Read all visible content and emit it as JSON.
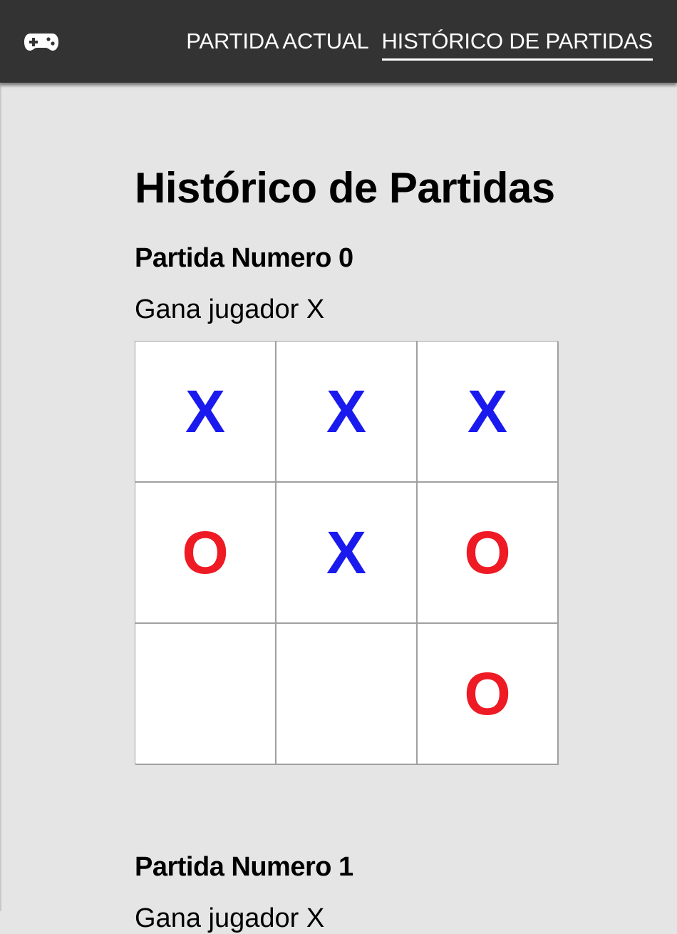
{
  "nav": {
    "brand_icon": "gamepad-icon",
    "links": [
      {
        "label": "PARTIDA ACTUAL",
        "active": false
      },
      {
        "label": "HISTÓRICO DE PARTIDAS",
        "active": true
      }
    ]
  },
  "page": {
    "title": "Histórico de Partidas"
  },
  "colors": {
    "x": "#1a1aee",
    "o": "#ee1a24"
  },
  "games": [
    {
      "title": "Partida Numero 0",
      "result": "Gana jugador X",
      "board": [
        "X",
        "X",
        "X",
        "O",
        "X",
        "O",
        "",
        "",
        "O"
      ]
    },
    {
      "title": "Partida Numero 1",
      "result": "Gana jugador X"
    }
  ]
}
